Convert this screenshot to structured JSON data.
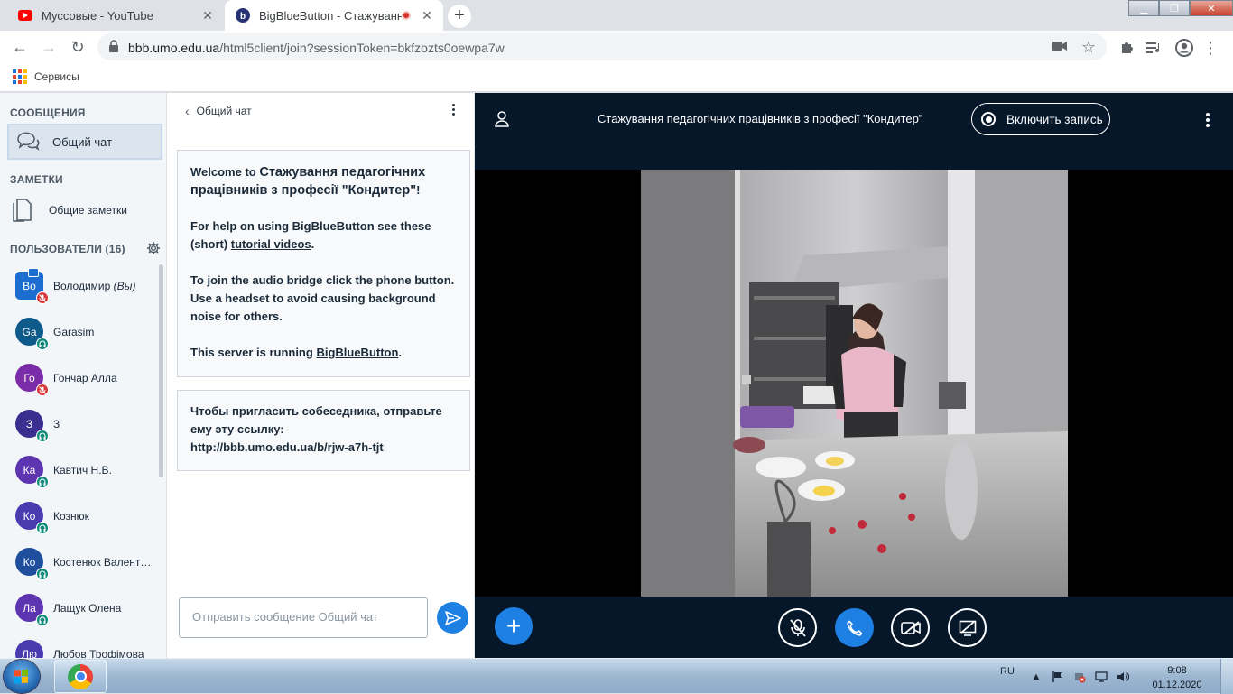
{
  "browser": {
    "tabs": [
      {
        "title": "Муссовые - YouTube",
        "active": false
      },
      {
        "title": "BigBlueButton - Стажування п",
        "active": true
      }
    ],
    "new_tab": "+",
    "url_host": "bbb.umo.edu.ua",
    "url_rest": "/html5client/join?sessionToken=bkfzozts0oewpa7w",
    "bookmarks": [
      {
        "label": "Сервисы"
      }
    ]
  },
  "sidebar": {
    "messages_title": "СООБЩЕНИЯ",
    "public_chat": "Общий чат",
    "notes_title": "ЗАМЕТКИ",
    "shared_notes": "Общие заметки",
    "users_title": "ПОЛЬЗОВАТЕЛИ (16)",
    "users": [
      {
        "initials": "Во",
        "name": "Володимир",
        "suffix": "(Вы)",
        "color": "#1c6dd0",
        "status": "muted",
        "me": true
      },
      {
        "initials": "Ga",
        "name": "Garasim",
        "suffix": "",
        "color": "#0e5a8a",
        "status": "listen",
        "me": false
      },
      {
        "initials": "Го",
        "name": "Гончар Алла",
        "suffix": "",
        "color": "#7b2ca8",
        "status": "muted",
        "me": false
      },
      {
        "initials": "З",
        "name": "З",
        "suffix": "",
        "color": "#3b2e8f",
        "status": "listen",
        "me": false
      },
      {
        "initials": "Ка",
        "name": "Кавтич Н.В.",
        "suffix": "",
        "color": "#5e35b1",
        "status": "listen",
        "me": false
      },
      {
        "initials": "Ко",
        "name": "Кознюк",
        "suffix": "",
        "color": "#4a3bb0",
        "status": "listen",
        "me": false
      },
      {
        "initials": "Ко",
        "name": "Костенюк Валент…",
        "suffix": "",
        "color": "#1f4e9c",
        "status": "listen",
        "me": false
      },
      {
        "initials": "Ла",
        "name": "Лащук Олена",
        "suffix": "",
        "color": "#5e35b1",
        "status": "listen",
        "me": false
      },
      {
        "initials": "Лю",
        "name": "Любов Трофімова",
        "suffix": "",
        "color": "#4a3bb0",
        "status": "listen",
        "me": false
      }
    ]
  },
  "chat": {
    "title": "Общий чат",
    "welcome_prefix": "Welcome to ",
    "welcome_meeting": "Стажування педагогічних працівників з професії \"Кондитер\"",
    "welcome_suffix": "!",
    "help_prefix": "For help on using BigBlueButton see these (short) ",
    "help_link": "tutorial videos",
    "help_suffix": ".",
    "audio_text": "To join the audio bridge click the phone button. Use a headset to avoid causing background noise for others.",
    "server_prefix": "This server is running ",
    "server_link": "BigBlueButton",
    "server_suffix": ".",
    "invite_text": "Чтобы пригласить собеседника, отправьте ему эту ссылку:",
    "invite_link": "http://bbb.umo.edu.ua/b/rjw-a7h-tjt",
    "input_placeholder": "Отправить сообщение Общий чат"
  },
  "meeting": {
    "title": "Стажування педагогічних працівників з професії \"Кондитер\"",
    "record_label": "Включить запись"
  },
  "controls": {
    "actions": "+",
    "mute_icon": "microphone-muted-icon",
    "phone_icon": "phone-icon",
    "camera_icon": "camera-off-icon",
    "screen_icon": "screenshare-off-icon"
  },
  "taskbar": {
    "lang": "RU",
    "time": "9:08",
    "date": "01.12.2020"
  },
  "colors": {
    "accent": "#1f80e3",
    "bbb_dark": "#06172a",
    "sidebar_bg": "#f3f6f9"
  }
}
